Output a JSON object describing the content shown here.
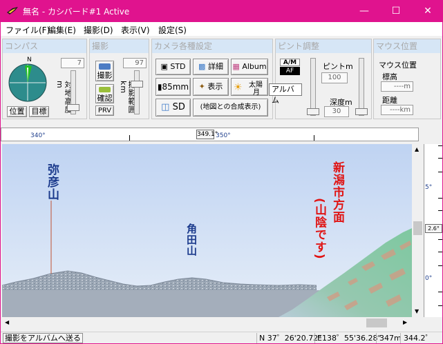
{
  "window": {
    "title": "無名 - カシバード#1 Active",
    "colors": {
      "titlebar": "#e0138e",
      "panel_header": "#d6e6f6",
      "sky_top": "#c6d8f4",
      "sky_bottom": "#e4ecf6"
    }
  },
  "menu": {
    "items": [
      "ファイル(F)",
      "編集(E)",
      "撮影(D)",
      "表示(V)",
      "設定(S)"
    ]
  },
  "compass": {
    "header": "コンパス",
    "north_label": "N",
    "distance_value": "7",
    "vertical_label": "対地高度m",
    "position_button": "位置",
    "target_button": "目標"
  },
  "shooting": {
    "header": "撮影",
    "range_value": "97",
    "shoot_button": "撮影",
    "confirm_button": "確認",
    "prv_button": "PRV",
    "vertical_label": "撮影範囲km"
  },
  "camera": {
    "header": "カメラ各種設定",
    "std_button": "STD",
    "detail_button": "詳細",
    "album_button": "Album",
    "lens_button": "85mm",
    "display_button": "表示",
    "sun_button_line1": "太陽",
    "sun_button_line2": "月",
    "sd_button": "SD",
    "map_composite_button": "(地図との合成表示)",
    "tooltip": "アルバム"
  },
  "focus": {
    "header": "ピント調整",
    "am_label": "A/M",
    "af_label": "AF",
    "focus_label": "ピントm",
    "focus_value": "100",
    "depth_label": "深度m",
    "depth_value": "30"
  },
  "mouse": {
    "header": "マウス位置",
    "position_label": "マウス位置",
    "elevation_label": "標高",
    "elevation_value": "----m",
    "distance_label": "距離",
    "distance_value": "----km"
  },
  "ruler": {
    "labels": [
      "340°",
      "350°"
    ],
    "current": "349.1°"
  },
  "elevation_scale": {
    "labels": [
      "5°",
      "2.6°",
      "0°"
    ]
  },
  "view": {
    "label_yahiko": "弥彦山",
    "label_kakuda": "角田山",
    "label_niigata": "新潟市方面",
    "label_sanin": "(山陰です)",
    "label_colors": {
      "yahiko": "#1b3a8c",
      "kakuda": "#1b3a8c",
      "niigata": "#e01414",
      "sanin": "#e01414"
    }
  },
  "status": {
    "album_send": "撮影をアルバムへ送る",
    "lat": "N 37゜26'20.72\"",
    "lon": "E138゜55'36.28\"",
    "alt": "347m",
    "bearing": "344.2゜"
  }
}
